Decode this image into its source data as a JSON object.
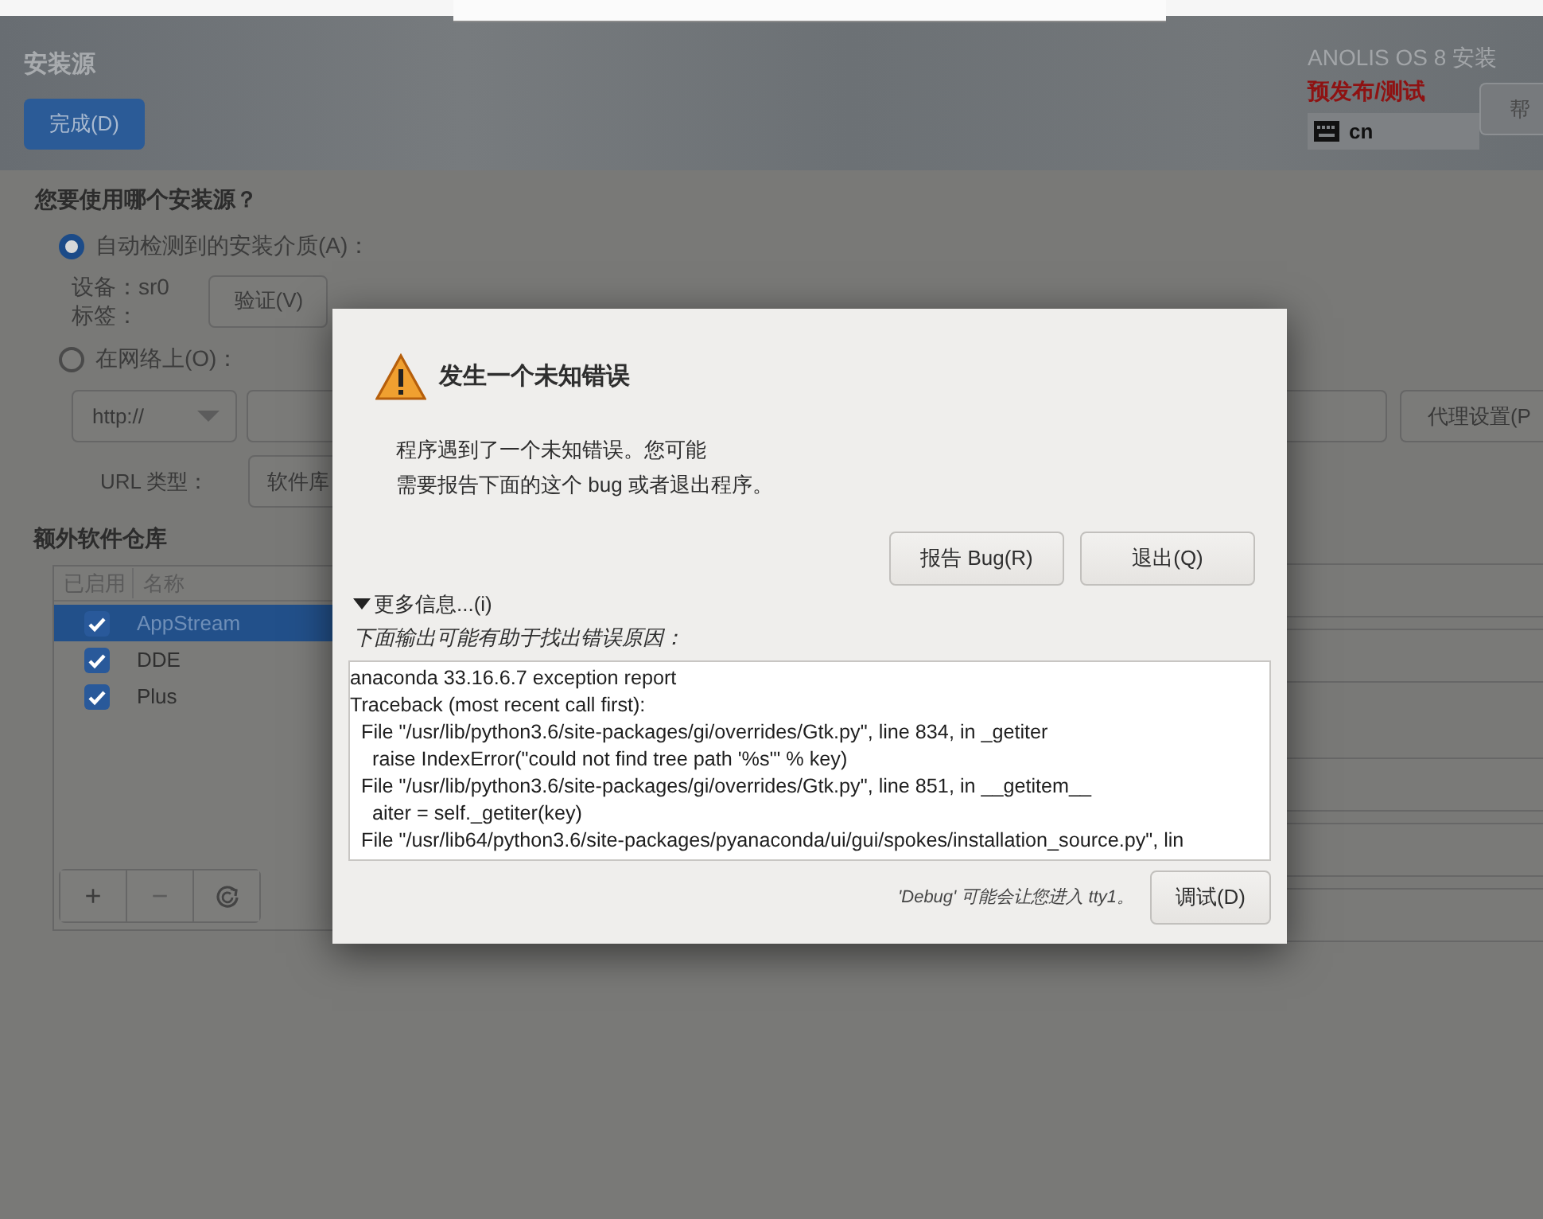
{
  "header": {
    "title": "安装源",
    "done_button": "完成(D)",
    "product": "ANOLIS OS 8 安装",
    "prerelease": "预发布/测试",
    "keyboard": "cn",
    "help_button": "帮"
  },
  "source": {
    "question": "您要使用哪个安装源？",
    "options": [
      {
        "label": "自动检测到的安装介质(A)：",
        "selected": true
      },
      {
        "label": "在网络上(O)：",
        "selected": false
      }
    ],
    "device": "设备：sr0",
    "disc_label": "标签：",
    "verify_button": "验证(V)",
    "protocol": "http://",
    "proxy_button": "代理设置(P",
    "url_type_label": "URL 类型：",
    "url_type_value": "软件库"
  },
  "repos": {
    "title": "额外软件仓库",
    "columns": [
      "已启用",
      "名称"
    ],
    "rows": [
      {
        "name": "AppStream",
        "enabled": true,
        "selected": true
      },
      {
        "name": "DDE",
        "enabled": true,
        "selected": false
      },
      {
        "name": "Plus",
        "enabled": true,
        "selected": false
      }
    ],
    "toolbar": [
      {
        "kind": "add",
        "label": "+"
      },
      {
        "kind": "remove",
        "label": "−"
      },
      {
        "kind": "refresh"
      }
    ]
  },
  "dialog": {
    "title": "发生一个未知错误",
    "message": [
      "程序遇到了一个未知错误。您可能",
      "需要报告下面的这个 bug 或者退出程序。"
    ],
    "buttons": [
      "报告 Bug(R)",
      "退出(Q)"
    ],
    "expander": {
      "label": "更多信息...(i)",
      "expanded": true
    },
    "hint": "下面输出可能有助于找出错误原因：",
    "log": [
      "anaconda 33.16.6.7 exception report",
      "Traceback (most recent call first):",
      "  File \"/usr/lib/python3.6/site-packages/gi/overrides/Gtk.py\", line 834, in _getiter",
      "    raise IndexError(\"could not find tree path '%s'\" % key)",
      "  File \"/usr/lib/python3.6/site-packages/gi/overrides/Gtk.py\", line 851, in __getitem__",
      "    aiter = self._getiter(key)",
      "  File \"/usr/lib64/python3.6/site-packages/pyanaconda/ui/gui/spokes/installation_source.py\", lin"
    ],
    "debug_note": "'Debug' 可能会让您进入 tty1。",
    "debug_button": "调试(D)"
  }
}
